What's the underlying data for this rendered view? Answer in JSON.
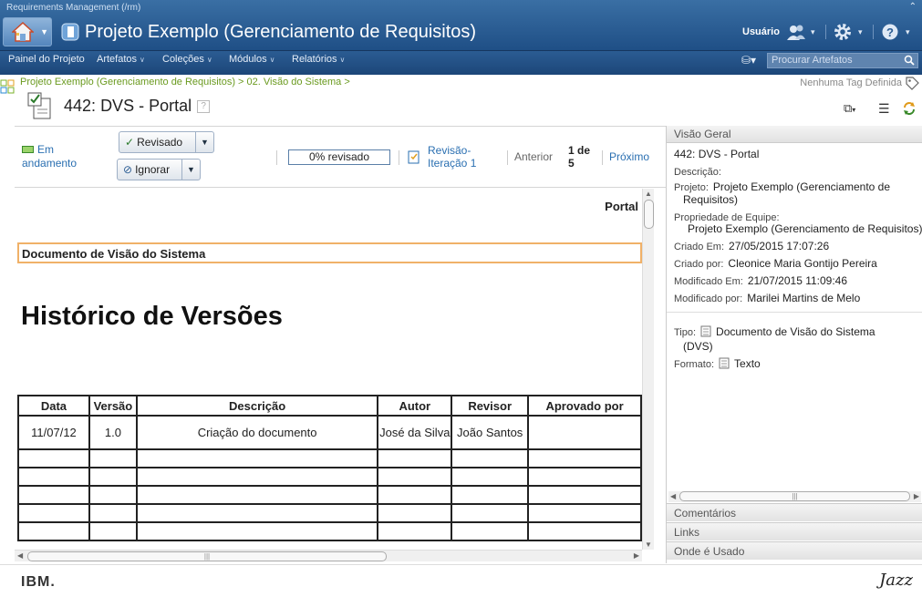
{
  "app_title": "Requirements Management (/rm)",
  "project_title": "Projeto Exemplo (Gerenciamento de Requisitos)",
  "user_label": "Usuário",
  "menu": [
    "Painel do Projeto",
    "Artefatos",
    "Coleções",
    "Módulos",
    "Relatórios"
  ],
  "search_placeholder": "Procurar Artefatos",
  "breadcrumb": "Projeto Exemplo (Gerenciamento de Requisitos) > 02. Visão do Sistema >",
  "tags": "Nenhuma Tag Definida",
  "artifact": {
    "id": "442:",
    "title": "DVS - Portal",
    "help": "?"
  },
  "toolbar": {
    "status_line1": "Em",
    "status_line2": "andamento",
    "revisado": "Revisado",
    "ignorar": "Ignorar",
    "progress": "0% revisado",
    "revisao_line1": "Revisão-",
    "revisao_line2": "Iteração 1",
    "anterior": "Anterior",
    "page_line1": "1 de",
    "page_line2": "5",
    "proximo": "Próximo"
  },
  "document": {
    "header_right": "Portal",
    "box_title": "Documento de Visão do Sistema",
    "heading": "Histórico de Versões",
    "table_headers": [
      "Data",
      "Versão",
      "Descrição",
      "Autor",
      "Revisor",
      "Aprovado por"
    ],
    "table_row": [
      "11/07/12",
      "1.0",
      "Criação do documento",
      "José da Silva",
      "João Santos",
      ""
    ]
  },
  "overview": {
    "header": "Visão Geral",
    "name": "442: DVS - Portal",
    "descricao_label": "Descrição:",
    "projeto_label": "Projeto:",
    "projeto_value1": "Projeto Exemplo (Gerenciamento de",
    "projeto_value2": "Requisitos)",
    "propriedade_label": "Propriedade de Equipe:",
    "propriedade_value": "Projeto Exemplo (Gerenciamento de Requisitos)",
    "criado_em_label": "Criado Em:",
    "criado_em": "27/05/2015 17:07:26",
    "criado_por_label": "Criado por:",
    "criado_por": "Cleonice Maria Gontijo Pereira",
    "modificado_em_label": "Modificado Em:",
    "modificado_em": "21/07/2015 11:09:46",
    "modificado_por_label": "Modificado por:",
    "modificado_por": "Marilei Martins de Melo",
    "tipo_label": "Tipo:",
    "tipo_value1": "Documento de Visão do Sistema",
    "tipo_value2": "(DVS)",
    "formato_label": "Formato:",
    "formato_value": "Texto"
  },
  "sections": [
    "Comentários",
    "Links",
    "Onde é Usado"
  ],
  "footer": {
    "left_logo": "IBM.",
    "right_logo": "Jazz"
  }
}
